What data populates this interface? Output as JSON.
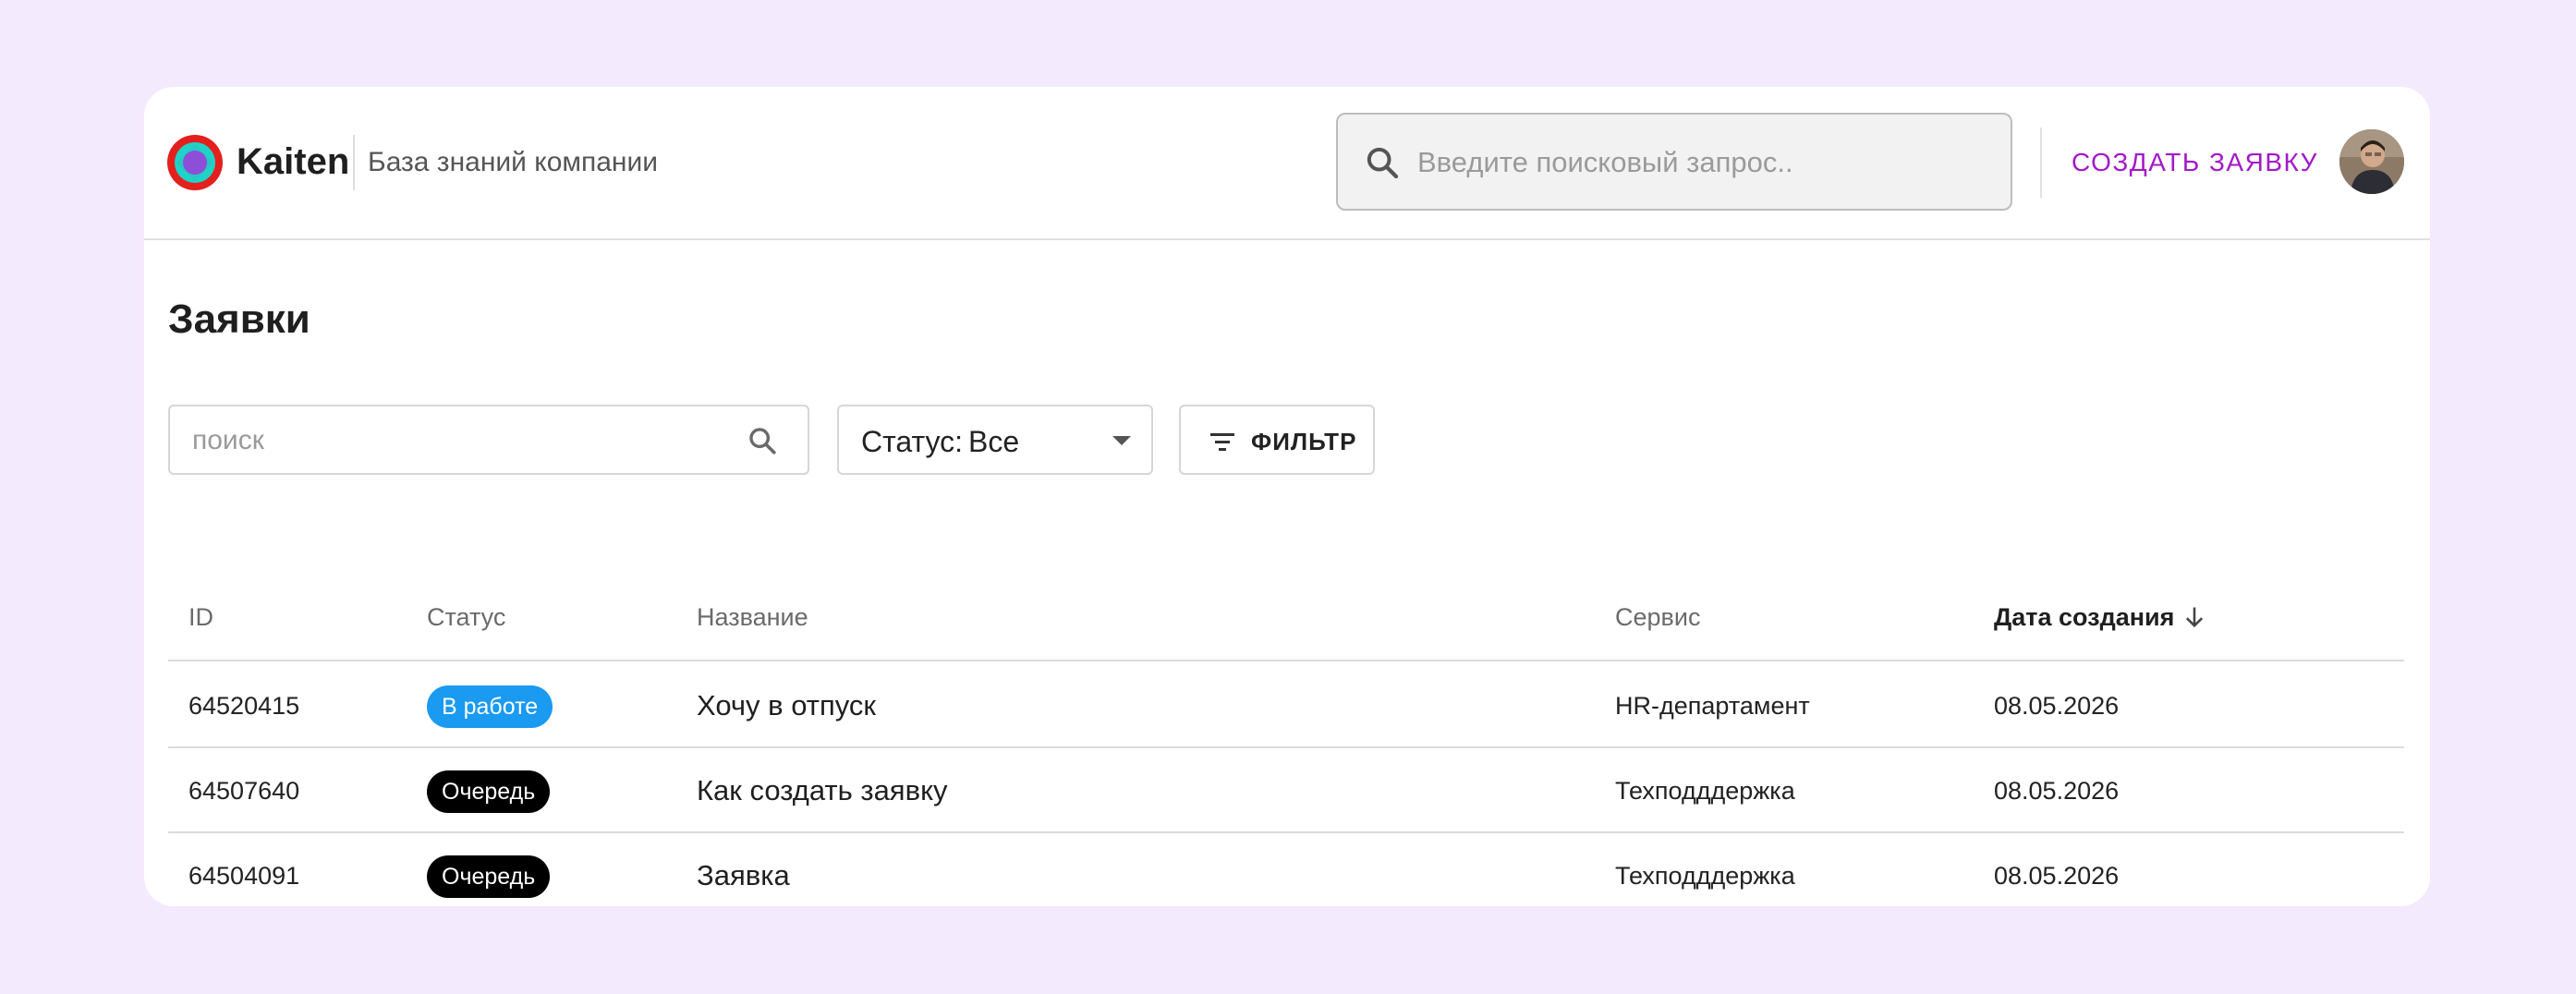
{
  "header": {
    "brand": "Kaiten",
    "kb_title": "База знаний компании",
    "search_placeholder": "Введите поисковый запрос..",
    "create_label": "СОЗДАТЬ ЗАЯВКУ"
  },
  "page": {
    "title": "Заявки"
  },
  "filters": {
    "search_placeholder": "поиск",
    "status_label": "Статус:",
    "status_value": "Все",
    "filter_label": "ФИЛЬТР"
  },
  "table": {
    "columns": {
      "id": "ID",
      "status": "Статус",
      "name": "Название",
      "service": "Сервис",
      "date": "Дата создания"
    },
    "rows": [
      {
        "id": "64520415",
        "status": "В работе",
        "status_color": "#1a9af0",
        "name": "Хочу в отпуск",
        "service": "HR-департамент",
        "date": "08.05.2026"
      },
      {
        "id": "64507640",
        "status": "Очередь",
        "status_color": "#000000",
        "name": "Как создать заявку",
        "service": "Техподддержка",
        "date": "08.05.2026"
      },
      {
        "id": "64504091",
        "status": "Очередь",
        "status_color": "#000000",
        "name": "Заявка",
        "service": "Техподддержка",
        "date": "08.05.2026"
      }
    ]
  },
  "colors": {
    "accent": "#a318c9",
    "background": "#f4eafd",
    "status_in_progress": "#1a9af0",
    "status_queue": "#000000"
  },
  "icons": {
    "logo": "kaiten-logo-icon",
    "search": "search-icon",
    "filter": "filter-icon",
    "sort": "arrow-down-icon",
    "dropdown": "caret-down-icon"
  }
}
